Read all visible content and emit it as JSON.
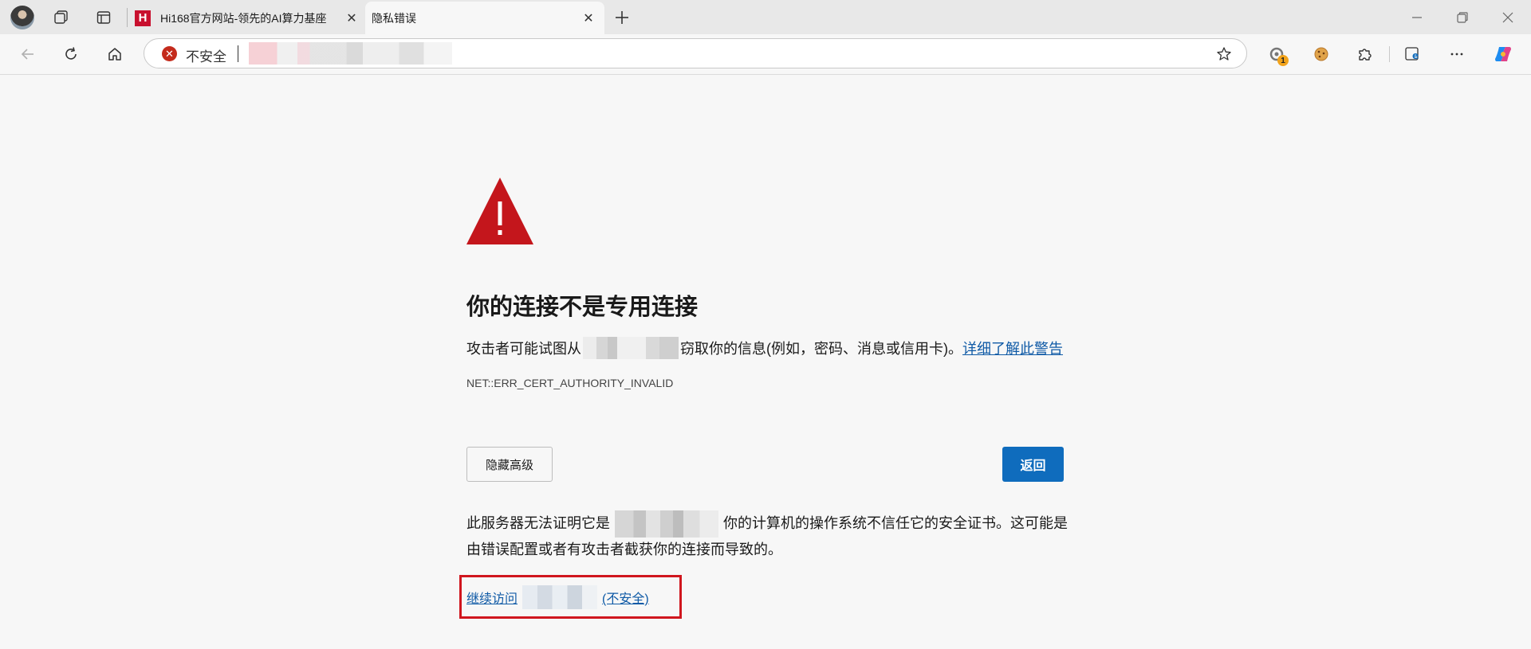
{
  "tabs": [
    {
      "title": "Hi168官方网站-领先的AI算力基座",
      "favicon_text": "H",
      "active": false
    },
    {
      "title": "隐私错误",
      "active": true
    }
  ],
  "toolbar": {
    "security_label": "不安全",
    "address_icon": "error-x-icon"
  },
  "page": {
    "title": "你的连接不是专用连接",
    "desc_prefix": "攻击者可能试图从",
    "desc_suffix": "窃取你的信息(例如，密码、消息或信用卡)。",
    "learn_more": "详细了解此警告",
    "error_code": "NET::ERR_CERT_AUTHORITY_INVALID",
    "hide_advanced": "隐藏高级",
    "back": "返回",
    "detail_prefix": "此服务器无法证明它是",
    "detail_suffix": "你的计算机的操作系统不信任它的安全证书。这可能是由错误配置或者有攻击者截获你的连接而导致的。",
    "proceed_prefix": "继续访问",
    "proceed_suffix": "(不安全)"
  },
  "colors": {
    "warning_red": "#c4161c",
    "primary_blue": "#0f6cbd",
    "link_blue": "#0f5aa6",
    "highlight_box": "#d0161e"
  }
}
